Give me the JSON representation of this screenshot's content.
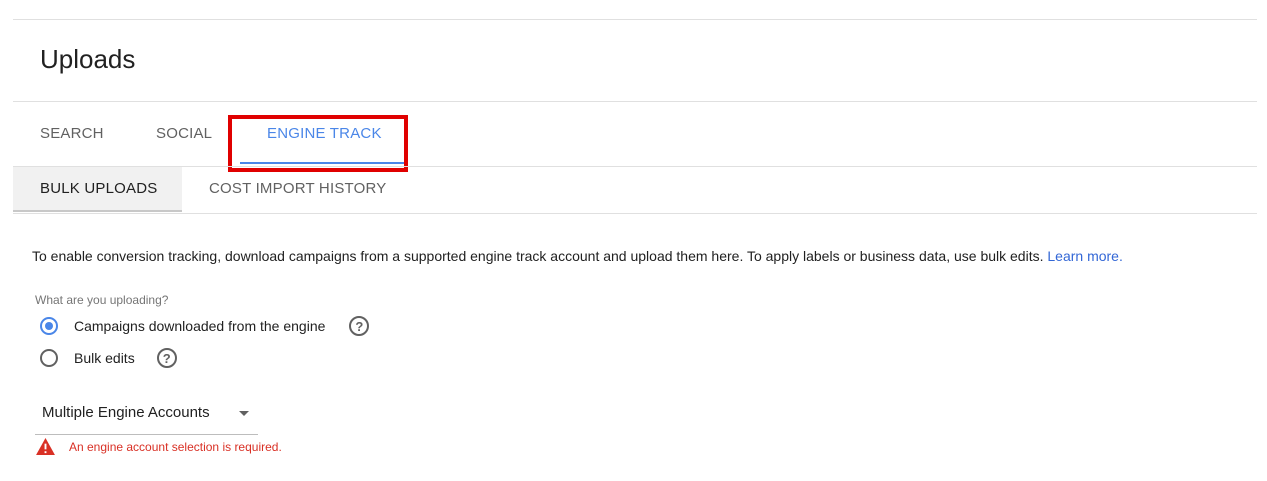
{
  "page": {
    "title": "Uploads"
  },
  "tabs": [
    {
      "label": "SEARCH",
      "active": false
    },
    {
      "label": "SOCIAL",
      "active": false
    },
    {
      "label": "ENGINE TRACK",
      "active": true
    }
  ],
  "subtabs": [
    {
      "label": "BULK UPLOADS",
      "active": true
    },
    {
      "label": "COST IMPORT HISTORY",
      "active": false
    }
  ],
  "description": {
    "text": "To enable conversion tracking, download campaigns from a supported engine track account and upload them here. To apply labels or business data, use bulk edits. ",
    "link": "Learn more."
  },
  "upload_type": {
    "question": "What are you uploading?",
    "options": [
      {
        "label": "Campaigns downloaded from the engine",
        "selected": true,
        "help_icon": "?"
      },
      {
        "label": "Bulk edits",
        "selected": false,
        "help_icon": "?"
      }
    ]
  },
  "engine_account": {
    "selected": "Multiple Engine Accounts",
    "error": "An engine account selection is required."
  },
  "colors": {
    "accent": "#4a86e8",
    "error": "#d93025",
    "highlight": "#e00000",
    "link": "#3367d6"
  }
}
